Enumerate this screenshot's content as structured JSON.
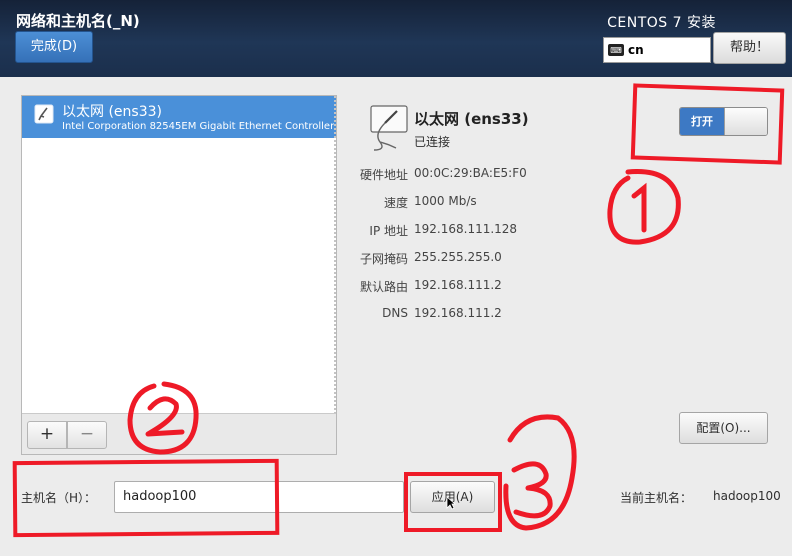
{
  "header": {
    "title": "网络和主机名(_N)",
    "done_label": "完成(D)",
    "product": "CENTOS 7 安装",
    "keyboard_layout": "cn",
    "keyboard_icon_label": "⌨",
    "help_label": "帮助！"
  },
  "device_list": {
    "items": [
      {
        "name": "以太网 (ens33)",
        "description": "Intel Corporation 82545EM Gigabit Ethernet Controller (C"
      }
    ],
    "add_label": "+",
    "remove_label": "−"
  },
  "device_detail": {
    "name": "以太网 (ens33)",
    "status": "已连接",
    "toggle_label": "打开",
    "toggle_on": true,
    "rows": [
      {
        "label": "硬件地址",
        "value": "00:0C:29:BA:E5:F0"
      },
      {
        "label": "速度",
        "value": "1000 Mb/s"
      },
      {
        "label": "IP 地址",
        "value": "192.168.111.128"
      },
      {
        "label": "子网掩码",
        "value": "255.255.255.0"
      },
      {
        "label": "默认路由",
        "value": "192.168.111.2"
      },
      {
        "label": "DNS",
        "value": "192.168.111.2"
      }
    ],
    "config_label": "配置(O)..."
  },
  "hostname": {
    "label": "主机名（H）：",
    "value": "hadoop100",
    "apply_label": "应用(A)",
    "current_label": "当前主机名：",
    "current_value": "hadoop100"
  },
  "colors": {
    "header_bg": "#1f3656",
    "selection": "#4a90d9",
    "annotation": "#ee1a27"
  },
  "annotations": [
    "①",
    "②",
    "③"
  ]
}
